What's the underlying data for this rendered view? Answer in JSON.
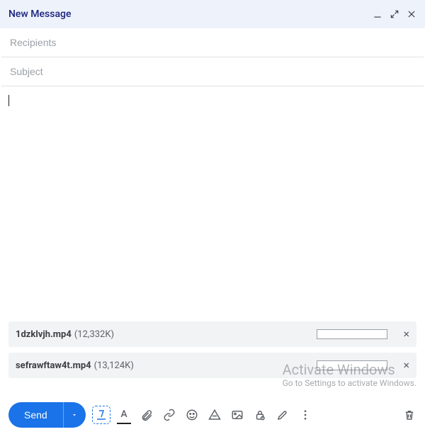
{
  "header": {
    "title": "New Message"
  },
  "fields": {
    "recipients_placeholder": "Recipients",
    "recipients_value": "",
    "subject_placeholder": "Subject",
    "subject_value": "",
    "body_value": ""
  },
  "attachments": [
    {
      "name": "1dzklvjh.mp4",
      "size": "(12,332K)"
    },
    {
      "name": "sefrawftaw4t.mp4",
      "size": "(13,124K)"
    }
  ],
  "toolbar": {
    "send_label": "Send"
  },
  "watermark": {
    "title": "Activate Windows",
    "sub": "Go to Settings to activate Windows."
  }
}
